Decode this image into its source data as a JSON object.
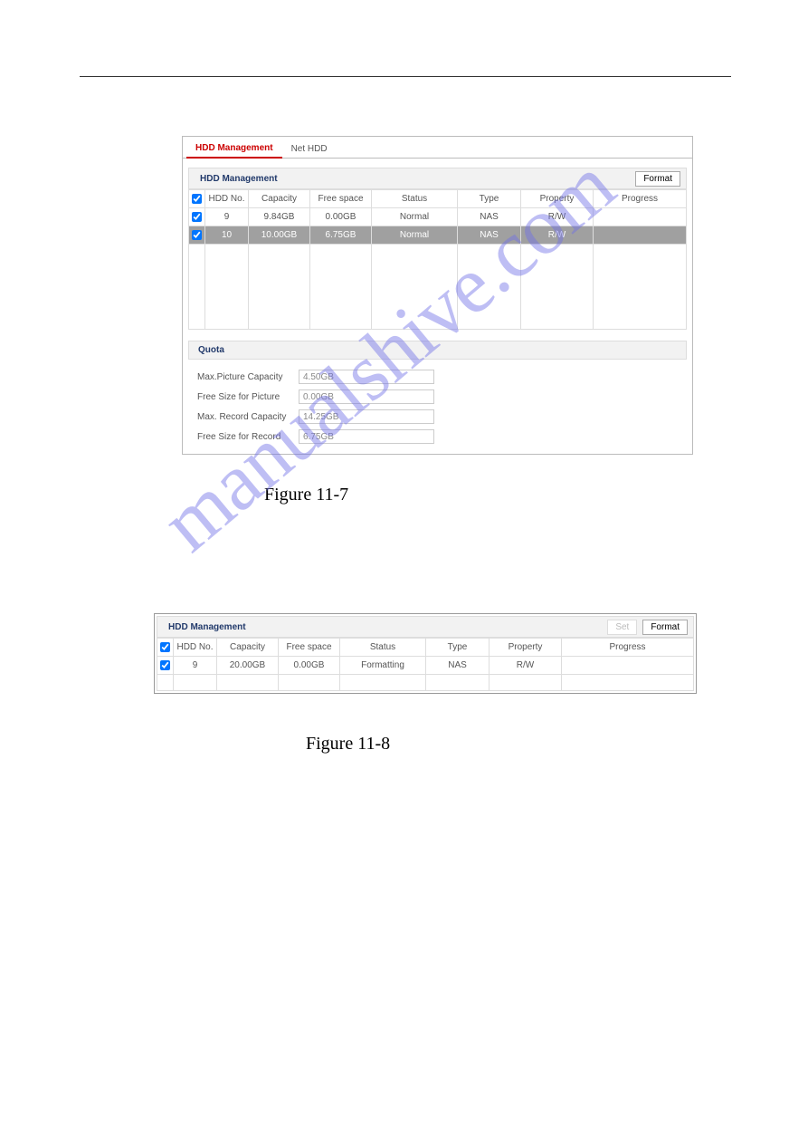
{
  "watermark": "manualshive.com",
  "figure1": {
    "tabs": {
      "active": "HDD Management",
      "inactive": "Net HDD"
    },
    "section_title": "HDD Management",
    "format_btn": "Format",
    "columns": [
      "HDD No.",
      "Capacity",
      "Free space",
      "Status",
      "Type",
      "Property",
      "Progress"
    ],
    "rows": [
      {
        "checked": true,
        "no": "9",
        "capacity": "9.84GB",
        "free": "0.00GB",
        "status": "Normal",
        "type": "NAS",
        "property": "R/W",
        "progress": ""
      },
      {
        "checked": true,
        "no": "10",
        "capacity": "10.00GB",
        "free": "6.75GB",
        "status": "Normal",
        "type": "NAS",
        "property": "R/W",
        "progress": "",
        "selected": true
      }
    ],
    "quota_title": "Quota",
    "quota": {
      "max_pic_label": "Max.Picture Capacity",
      "max_pic_val": "4.50GB",
      "free_pic_label": "Free Size for Picture",
      "free_pic_val": "0.00GB",
      "max_rec_label": "Max. Record Capacity",
      "max_rec_val": "14.25GB",
      "free_rec_label": "Free Size for Record",
      "free_rec_val": "6.75GB"
    },
    "caption": "Figure 11-7"
  },
  "figure2": {
    "section_title": "HDD Management",
    "set_btn": "Set",
    "format_btn": "Format",
    "columns": [
      "HDD No.",
      "Capacity",
      "Free space",
      "Status",
      "Type",
      "Property",
      "Progress"
    ],
    "rows": [
      {
        "checked": true,
        "no": "9",
        "capacity": "20.00GB",
        "free": "0.00GB",
        "status": "Formatting",
        "type": "NAS",
        "property": "R/W",
        "progress": ""
      }
    ],
    "caption": "Figure 11-8"
  }
}
